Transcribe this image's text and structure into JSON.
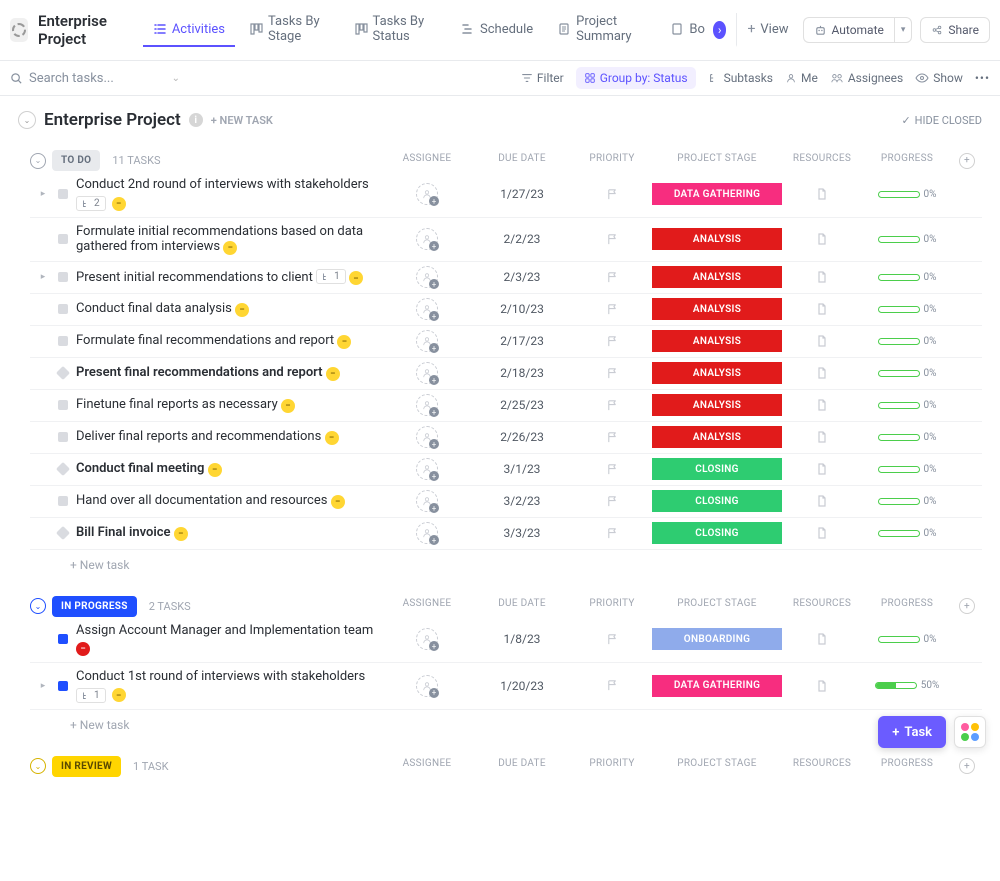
{
  "project_title": "Enterprise Project",
  "tabs": [
    "Activities",
    "Tasks By Stage",
    "Tasks By Status",
    "Schedule",
    "Project Summary",
    "Bo"
  ],
  "view_btn": "View",
  "automate_btn": "Automate",
  "share_btn": "Share",
  "search_placeholder": "Search tasks...",
  "toolbar": {
    "filter": "Filter",
    "groupby": "Group by: Status",
    "subtasks": "Subtasks",
    "me": "Me",
    "assignees": "Assignees",
    "show": "Show"
  },
  "list_title": "Enterprise Project",
  "new_task_btn": "+ NEW TASK",
  "hide_closed": "HIDE CLOSED",
  "columns": [
    "ASSIGNEE",
    "DUE DATE",
    "PRIORITY",
    "PROJECT STAGE",
    "RESOURCES",
    "PROGRESS"
  ],
  "new_task_row": "+ New task",
  "fab_task": "Task",
  "colors": {
    "todo_pill_bg": "#e8eaed",
    "todo_pill_text": "#656f7d",
    "inprogress_pill_bg": "#1f4fff",
    "inprogress_pill_text": "#ffffff",
    "inprogress_collapse": "#1f4fff",
    "inreview_pill_bg": "#ffd500",
    "inreview_pill_text": "#5a4a00",
    "inreview_collapse": "#d6b300",
    "stage_data_gathering": "#f72d7f",
    "stage_analysis": "#e11b1b",
    "stage_closing": "#2ecc71",
    "stage_onboarding": "#8fabeb",
    "prio_normal_bg": "#ffd633",
    "prio_normal_fg": "#7a5c00",
    "prio_urgent_bg": "#e11b1b",
    "prio_urgent_fg": "#ffffff",
    "status_todo_sq": "#d9dbe0",
    "status_inprogress_sq": "#1f4fff"
  },
  "groups": [
    {
      "id": "todo",
      "label": "TO DO",
      "count": "11 TASKS",
      "pill_bg": "#e8eaed",
      "pill_fg": "#656f7d",
      "collapse_color": "#a0a6b1",
      "status_sq_color": "#d9dbe0",
      "status_sq_rot": false,
      "show_new_task": true,
      "tasks": [
        {
          "title": "Conduct 2nd round of interviews with stakeholders",
          "due": "1/27/23",
          "stage": "DATA GATHERING",
          "stage_color": "#f72d7f",
          "progress": 0,
          "bold": false,
          "expand": true,
          "subtasks": "2",
          "prio": "normal"
        },
        {
          "title": "Formulate initial recommendations based on data gathered from interviews",
          "due": "2/2/23",
          "stage": "ANALYSIS",
          "stage_color": "#e11b1b",
          "progress": 0,
          "bold": false,
          "expand": false,
          "prio_inline": "normal"
        },
        {
          "title": "Present initial recommendations to client",
          "due": "2/3/23",
          "stage": "ANALYSIS",
          "stage_color": "#e11b1b",
          "progress": 0,
          "bold": false,
          "expand": true,
          "subtasks_inline": "1",
          "prio_inline": "normal"
        },
        {
          "title": "Conduct final data analysis",
          "due": "2/10/23",
          "stage": "ANALYSIS",
          "stage_color": "#e11b1b",
          "progress": 0,
          "bold": false,
          "expand": false,
          "prio_inline": "normal"
        },
        {
          "title": "Formulate final recommendations and report",
          "due": "2/17/23",
          "stage": "ANALYSIS",
          "stage_color": "#e11b1b",
          "progress": 0,
          "bold": false,
          "expand": false,
          "prio_inline": "normal"
        },
        {
          "title": "Present final recommendations and report",
          "due": "2/18/23",
          "stage": "ANALYSIS",
          "stage_color": "#e11b1b",
          "progress": 0,
          "bold": true,
          "expand": false,
          "prio_inline": "normal",
          "diamond": true
        },
        {
          "title": "Finetune final reports as necessary",
          "due": "2/25/23",
          "stage": "ANALYSIS",
          "stage_color": "#e11b1b",
          "progress": 0,
          "bold": false,
          "expand": false,
          "prio_inline": "normal"
        },
        {
          "title": "Deliver final reports and recommendations",
          "due": "2/26/23",
          "stage": "ANALYSIS",
          "stage_color": "#e11b1b",
          "progress": 0,
          "bold": false,
          "expand": false,
          "prio_inline": "normal"
        },
        {
          "title": "Conduct final meeting",
          "due": "3/1/23",
          "stage": "CLOSING",
          "stage_color": "#2ecc71",
          "progress": 0,
          "bold": true,
          "expand": false,
          "prio_inline": "normal",
          "diamond": true
        },
        {
          "title": "Hand over all documentation and resources",
          "due": "3/2/23",
          "stage": "CLOSING",
          "stage_color": "#2ecc71",
          "progress": 0,
          "bold": false,
          "expand": false,
          "prio_inline": "normal"
        },
        {
          "title": "Bill Final invoice",
          "due": "3/3/23",
          "stage": "CLOSING",
          "stage_color": "#2ecc71",
          "progress": 0,
          "bold": true,
          "expand": false,
          "prio_inline": "normal",
          "diamond": true
        }
      ]
    },
    {
      "id": "inprogress",
      "label": "IN PROGRESS",
      "count": "2 TASKS",
      "pill_bg": "#1f4fff",
      "pill_fg": "#ffffff",
      "collapse_color": "#1f4fff",
      "status_sq_color": "#1f4fff",
      "status_sq_rot": false,
      "show_new_task": true,
      "tasks": [
        {
          "title": "Assign Account Manager and Implementation team",
          "due": "1/8/23",
          "stage": "ONBOARDING",
          "stage_color": "#8fabeb",
          "progress": 0,
          "bold": false,
          "expand": false,
          "sub_prio_line": true,
          "prio": "urgent"
        },
        {
          "title": "Conduct 1st round of interviews with stakeholders",
          "due": "1/20/23",
          "stage": "DATA GATHERING",
          "stage_color": "#f72d7f",
          "progress": 50,
          "bold": false,
          "expand": true,
          "subtasks": "1",
          "prio": "normal"
        }
      ]
    },
    {
      "id": "inreview",
      "label": "IN REVIEW",
      "count": "1 TASK",
      "pill_bg": "#ffd500",
      "pill_fg": "#5a4a00",
      "collapse_color": "#d6b300",
      "status_sq_color": "#ffd500",
      "status_sq_rot": false,
      "show_new_task": false,
      "tasks": []
    }
  ]
}
